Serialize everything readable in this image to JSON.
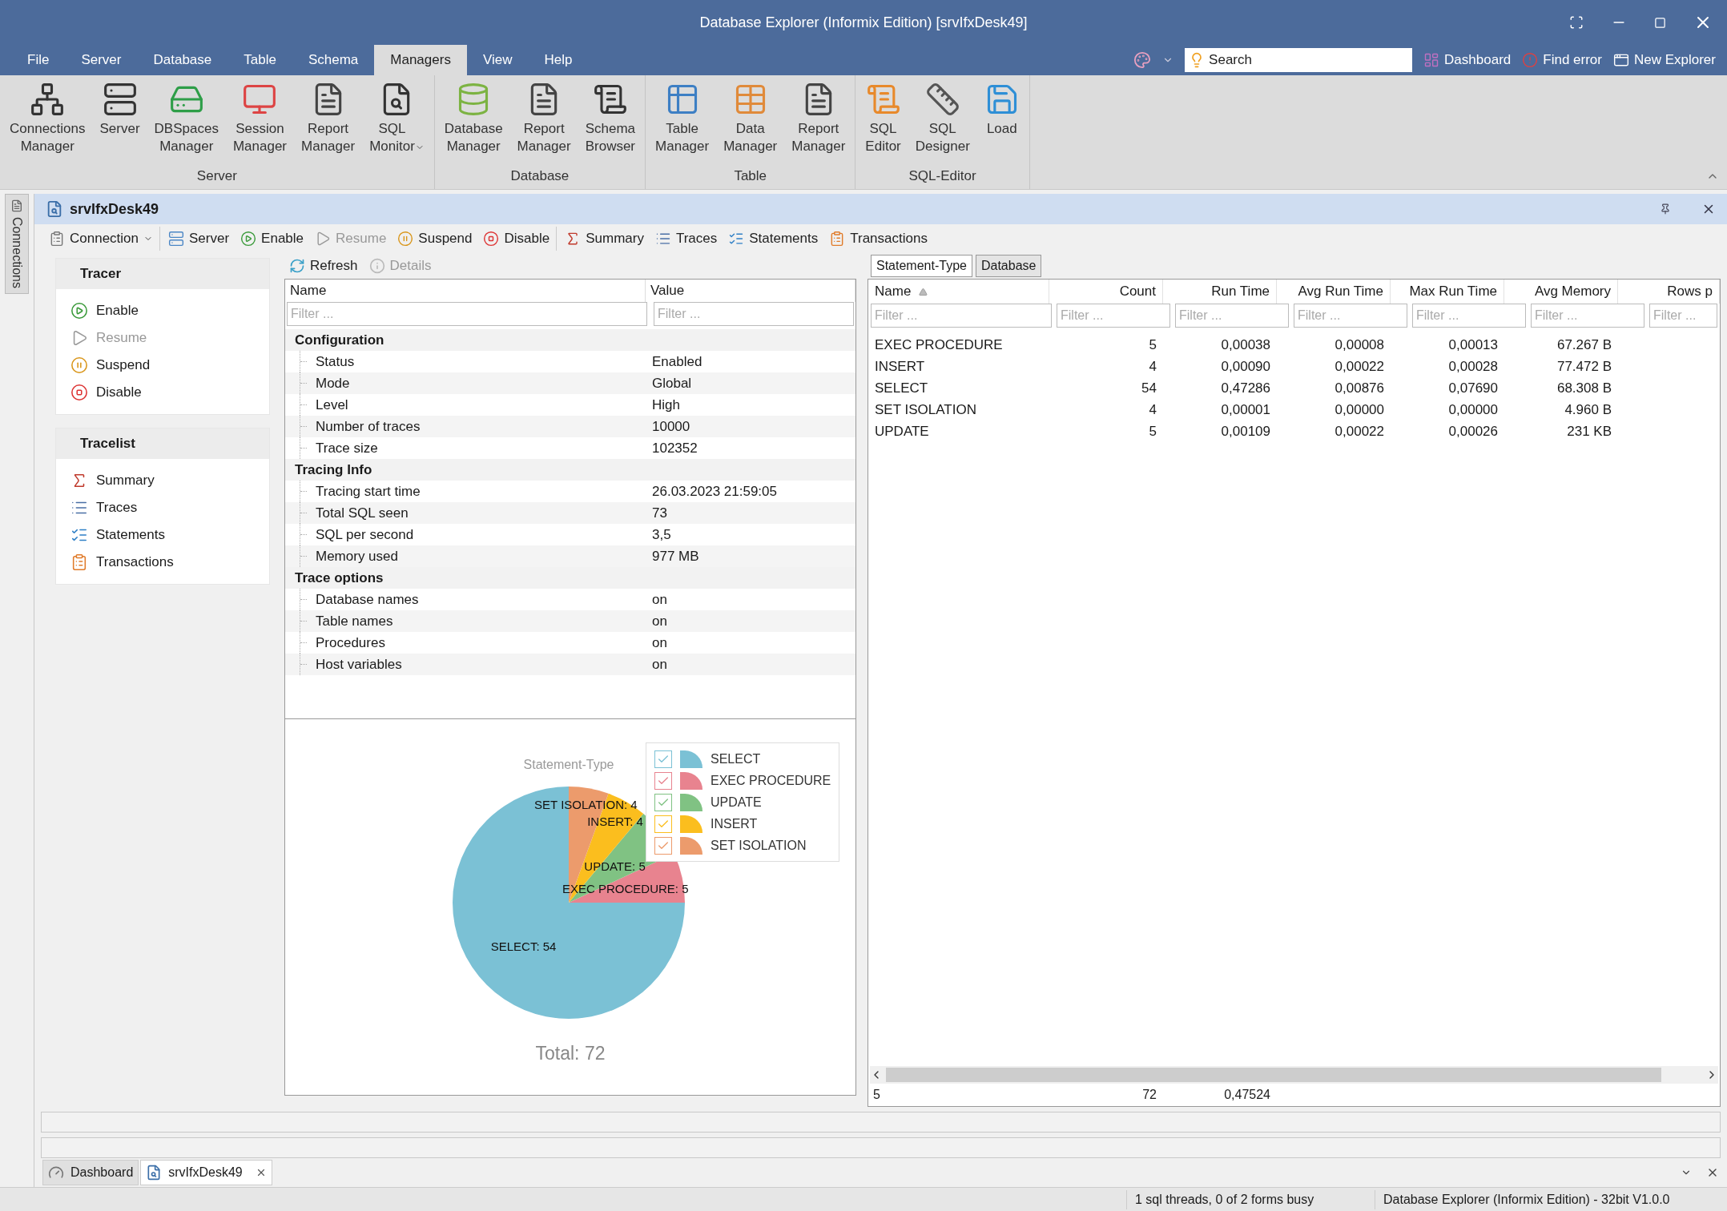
{
  "window": {
    "title": "Database Explorer (Informix Edition) [srvIfxDesk49]"
  },
  "menu_tabs": [
    {
      "label": "File",
      "selected": false
    },
    {
      "label": "Server",
      "selected": false
    },
    {
      "label": "Database",
      "selected": false
    },
    {
      "label": "Table",
      "selected": false
    },
    {
      "label": "Schema",
      "selected": false
    },
    {
      "label": "Managers",
      "selected": true
    },
    {
      "label": "View",
      "selected": false
    },
    {
      "label": "Help",
      "selected": false
    }
  ],
  "quick_search": {
    "placeholder": "Search"
  },
  "quick_links": [
    "Dashboard",
    "Find error",
    "New Explorer"
  ],
  "ribbon": {
    "groups": [
      {
        "label": "Server",
        "buttons": [
          {
            "label": "Connections Manager",
            "dropdown": false
          },
          {
            "label": "Server",
            "dropdown": false
          },
          {
            "label": "DBSpaces Manager",
            "dropdown": false
          },
          {
            "label": "Session Manager",
            "dropdown": false
          },
          {
            "label": "Report Manager",
            "dropdown": false
          },
          {
            "label": "SQL Monitor",
            "dropdown": true
          }
        ]
      },
      {
        "label": "Database",
        "buttons": [
          {
            "label": "Database Manager",
            "dropdown": false
          },
          {
            "label": "Report Manager",
            "dropdown": false
          },
          {
            "label": "Schema Browser",
            "dropdown": false
          }
        ]
      },
      {
        "label": "Table",
        "buttons": [
          {
            "label": "Table Manager",
            "dropdown": false
          },
          {
            "label": "Data Manager",
            "dropdown": false
          },
          {
            "label": "Report Manager",
            "dropdown": false
          }
        ]
      },
      {
        "label": "SQL-Editor",
        "buttons": [
          {
            "label": "SQL Editor",
            "dropdown": false
          },
          {
            "label": "SQL Designer",
            "dropdown": false
          },
          {
            "label": "Load",
            "dropdown": false
          }
        ]
      }
    ]
  },
  "side_tab": "Connections",
  "document": {
    "title": "srvIfxDesk49",
    "toolbar": [
      {
        "label": "Connection",
        "dropdown": true,
        "disabled": false
      },
      {
        "label": "Server",
        "dropdown": false,
        "disabled": false
      },
      {
        "label": "Enable",
        "dropdown": false,
        "disabled": false
      },
      {
        "label": "Resume",
        "dropdown": false,
        "disabled": true
      },
      {
        "label": "Suspend",
        "dropdown": false,
        "disabled": false
      },
      {
        "label": "Disable",
        "dropdown": false,
        "disabled": false
      },
      {
        "label": "Summary",
        "dropdown": false,
        "disabled": false
      },
      {
        "label": "Traces",
        "dropdown": false,
        "disabled": false
      },
      {
        "label": "Statements",
        "dropdown": false,
        "disabled": false
      },
      {
        "label": "Transactions",
        "dropdown": false,
        "disabled": false
      }
    ],
    "subtoolbar": [
      {
        "label": "Refresh",
        "disabled": false
      },
      {
        "label": "Details",
        "disabled": true
      }
    ],
    "nav": [
      {
        "title": "Tracer",
        "items": [
          {
            "label": "Enable",
            "disabled": false
          },
          {
            "label": "Resume",
            "disabled": true
          },
          {
            "label": "Suspend",
            "disabled": false
          },
          {
            "label": "Disable",
            "disabled": false
          }
        ]
      },
      {
        "title": "Tracelist",
        "items": [
          {
            "label": "Summary",
            "disabled": false
          },
          {
            "label": "Traces",
            "disabled": false
          },
          {
            "label": "Statements",
            "disabled": false
          },
          {
            "label": "Transactions",
            "disabled": false
          }
        ]
      }
    ],
    "properties": {
      "columns": [
        "Name",
        "Value"
      ],
      "filter_placeholders": [
        "Filter ...",
        "Filter ..."
      ],
      "groups": [
        {
          "label": "Configuration",
          "children": [
            {
              "name": "Status",
              "value": "Enabled"
            },
            {
              "name": "Mode",
              "value": "Global"
            },
            {
              "name": "Level",
              "value": "High"
            },
            {
              "name": "Number of traces",
              "value": "10000"
            },
            {
              "name": "Trace size",
              "value": "102352"
            }
          ]
        },
        {
          "label": "Tracing Info",
          "children": [
            {
              "name": "Tracing start time",
              "value": "26.03.2023 21:59:05"
            },
            {
              "name": "Total SQL seen",
              "value": "73"
            },
            {
              "name": "SQL per second",
              "value": "3,5"
            },
            {
              "name": "Memory used",
              "value": "977 MB"
            }
          ]
        },
        {
          "label": "Trace options",
          "children": [
            {
              "name": "Database names",
              "value": "on"
            },
            {
              "name": "Table names",
              "value": "on"
            },
            {
              "name": "Procedures",
              "value": "on"
            },
            {
              "name": "Host variables",
              "value": "on"
            }
          ]
        }
      ]
    },
    "chart": {
      "total": "Total: 72",
      "legend": [
        {
          "label": "SELECT",
          "color": "#7bc1d5",
          "checked": true
        },
        {
          "label": "EXEC PROCEDURE",
          "color": "#e8838f",
          "checked": true
        },
        {
          "label": "UPDATE",
          "color": "#80c283",
          "checked": true
        },
        {
          "label": "INSERT",
          "color": "#fbbe1e",
          "checked": true
        },
        {
          "label": "SET ISOLATION",
          "color": "#ec9b6c",
          "checked": true
        }
      ],
      "chart_data": {
        "type": "pie",
        "title": "Statement-Type",
        "values": [
          54,
          5,
          5,
          4,
          4
        ],
        "value_labels": [
          "SELECT: 54",
          "EXEC PROCEDURE: 5",
          "UPDATE: 5",
          "INSERT: 4",
          "SET ISOLATION: 4"
        ]
      }
    },
    "stats": {
      "tabs": [
        {
          "label": "Statement-Type",
          "selected": true
        },
        {
          "label": "Database",
          "selected": false
        }
      ],
      "columns": [
        {
          "label": "Name",
          "sorted": true
        },
        {
          "label": "Count",
          "sorted": false
        },
        {
          "label": "Run Time",
          "sorted": false
        },
        {
          "label": "Avg Run Time",
          "sorted": false
        },
        {
          "label": "Max Run Time",
          "sorted": false
        },
        {
          "label": "Avg Memory",
          "sorted": false
        },
        {
          "label": "Rows p",
          "sorted": false
        }
      ],
      "filter_placeholders": [
        "Filter ...",
        "Filter ...",
        "Filter ...",
        "Filter ...",
        "Filter ...",
        "Filter ...",
        "Filter ..."
      ],
      "rows": [
        [
          "EXEC PROCEDURE",
          "5",
          "0,00038",
          "0,00008",
          "0,00013",
          "67.267 B"
        ],
        [
          "INSERT",
          "4",
          "0,00090",
          "0,00022",
          "0,00028",
          "77.472 B"
        ],
        [
          "SELECT",
          "54",
          "0,47286",
          "0,00876",
          "0,07690",
          "68.308 B"
        ],
        [
          "SET ISOLATION",
          "4",
          "0,00001",
          "0,00000",
          "0,00000",
          "4.960 B"
        ],
        [
          "UPDATE",
          "5",
          "0,00109",
          "0,00022",
          "0,00026",
          "231 KB"
        ]
      ],
      "footer": {
        "name": "5",
        "count": "72",
        "run_time": "0,47524"
      }
    }
  },
  "doc_tabs": [
    {
      "label": "Dashboard",
      "selected": false,
      "closable": false
    },
    {
      "label": "srvIfxDesk49",
      "selected": true,
      "closable": true
    }
  ],
  "status_bar": [
    "1 sql threads, 0 of 2 forms busy",
    "Database Explorer (Informix Edition) - 32bit V1.0.0"
  ]
}
